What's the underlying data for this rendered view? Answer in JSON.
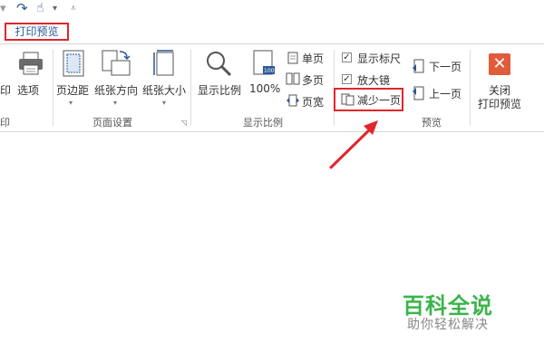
{
  "qat": {
    "redo_glyph": "↷",
    "touch_glyph": "☝",
    "dropdown_glyph": "▾",
    "customize_glyph": "⩡"
  },
  "tabs": {
    "active": "打印预览"
  },
  "ribbon": {
    "print_group": {
      "partial_button": "印",
      "options_button": "选项",
      "label_fragment": "印"
    },
    "page_setup": {
      "margins": "页边距",
      "orientation": "纸张方向",
      "size": "纸张大小",
      "label": "页面设置"
    },
    "zoom": {
      "zoom_button": "显示比例",
      "hundred_button": "100%",
      "single_page": "单页",
      "multi_page": "多页",
      "page_width": "页宽",
      "label": "显示比例"
    },
    "preview": {
      "show_ruler": "显示标尺",
      "show_ruler_checked": true,
      "magnifier": "放大镜",
      "magnifier_checked": true,
      "shrink_one_page": "减少一页",
      "next_page": "下一页",
      "prev_page": "上一页",
      "label": "预览"
    },
    "close": {
      "line1": "关闭",
      "line2": "打印预览"
    }
  },
  "watermark": {
    "title": "百科全说",
    "subtitle": "助你轻松解决"
  },
  "colors": {
    "highlight": "#e0262c",
    "brand_blue": "#2b579a",
    "watermark_green": "#3bb44a",
    "close_red": "#e05a3c"
  },
  "checkmark": "✓"
}
